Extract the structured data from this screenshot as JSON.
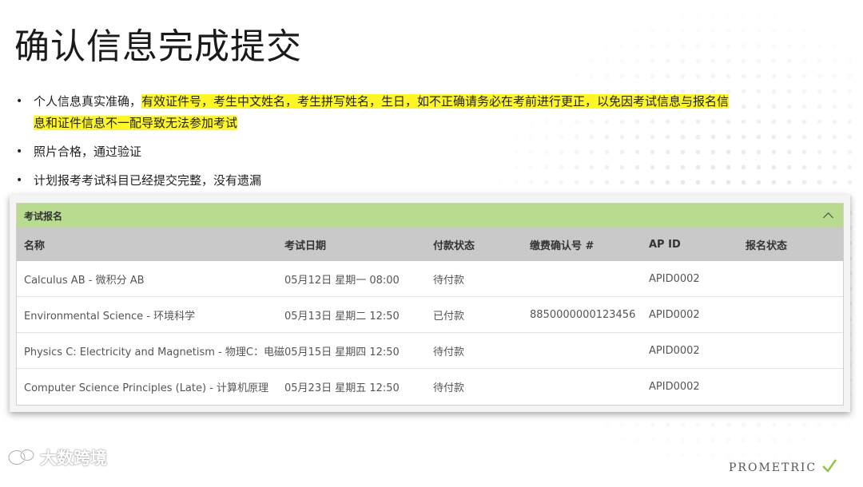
{
  "slide": {
    "title": "确认信息完成提交",
    "bullets": [
      {
        "plain": "个人信息真实准确，",
        "highlight": "有效证件号，考生中文姓名，考生拼写姓名，生日，如不正确请务必在考前进行更正，以免因考试信息与报名信息和证件信息不一配导致无法参加考试"
      },
      {
        "plain": "照片合格，通过验证",
        "highlight": ""
      },
      {
        "plain": "计划报考考试科目已经提交完整，没有遗漏",
        "highlight": ""
      }
    ],
    "bullet_symbol": "•"
  },
  "panel": {
    "title": "考试报名",
    "columns": [
      "名称",
      "考试日期",
      "付款状态",
      "缴费确认号 #",
      "AP ID",
      "报名状态"
    ],
    "rows": [
      {
        "name": "Calculus AB - 微积分 AB",
        "date": "05月12日 星期一 08:00",
        "payment": "待付款",
        "confirmation": "",
        "ap_id": "APID0002",
        "status": ""
      },
      {
        "name": "Environmental Science - 环境科学",
        "date": "05月13日 星期二 12:50",
        "payment": "已付款",
        "confirmation": "8850000000123456",
        "ap_id": "APID0002",
        "status": ""
      },
      {
        "name": "Physics C: Electricity and Magnetism - 物理C：电磁",
        "date": "05月15日 星期四 12:50",
        "payment": "待付款",
        "confirmation": "",
        "ap_id": "APID0002",
        "status": ""
      },
      {
        "name": "Computer Science Principles (Late) - 计算机原理",
        "date": "05月23日 星期五 12:50",
        "payment": "待付款",
        "confirmation": "",
        "ap_id": "APID0002",
        "status": ""
      }
    ]
  },
  "watermark": {
    "text": "大数跨境",
    "icon": "wechat-logo-icon"
  },
  "brand": {
    "text": "PROMETRIC",
    "icon": "prometric-check-icon"
  },
  "colors": {
    "header_green": "#b9db8f",
    "table_head": "#c9c9c9",
    "highlight": "#fff626"
  }
}
